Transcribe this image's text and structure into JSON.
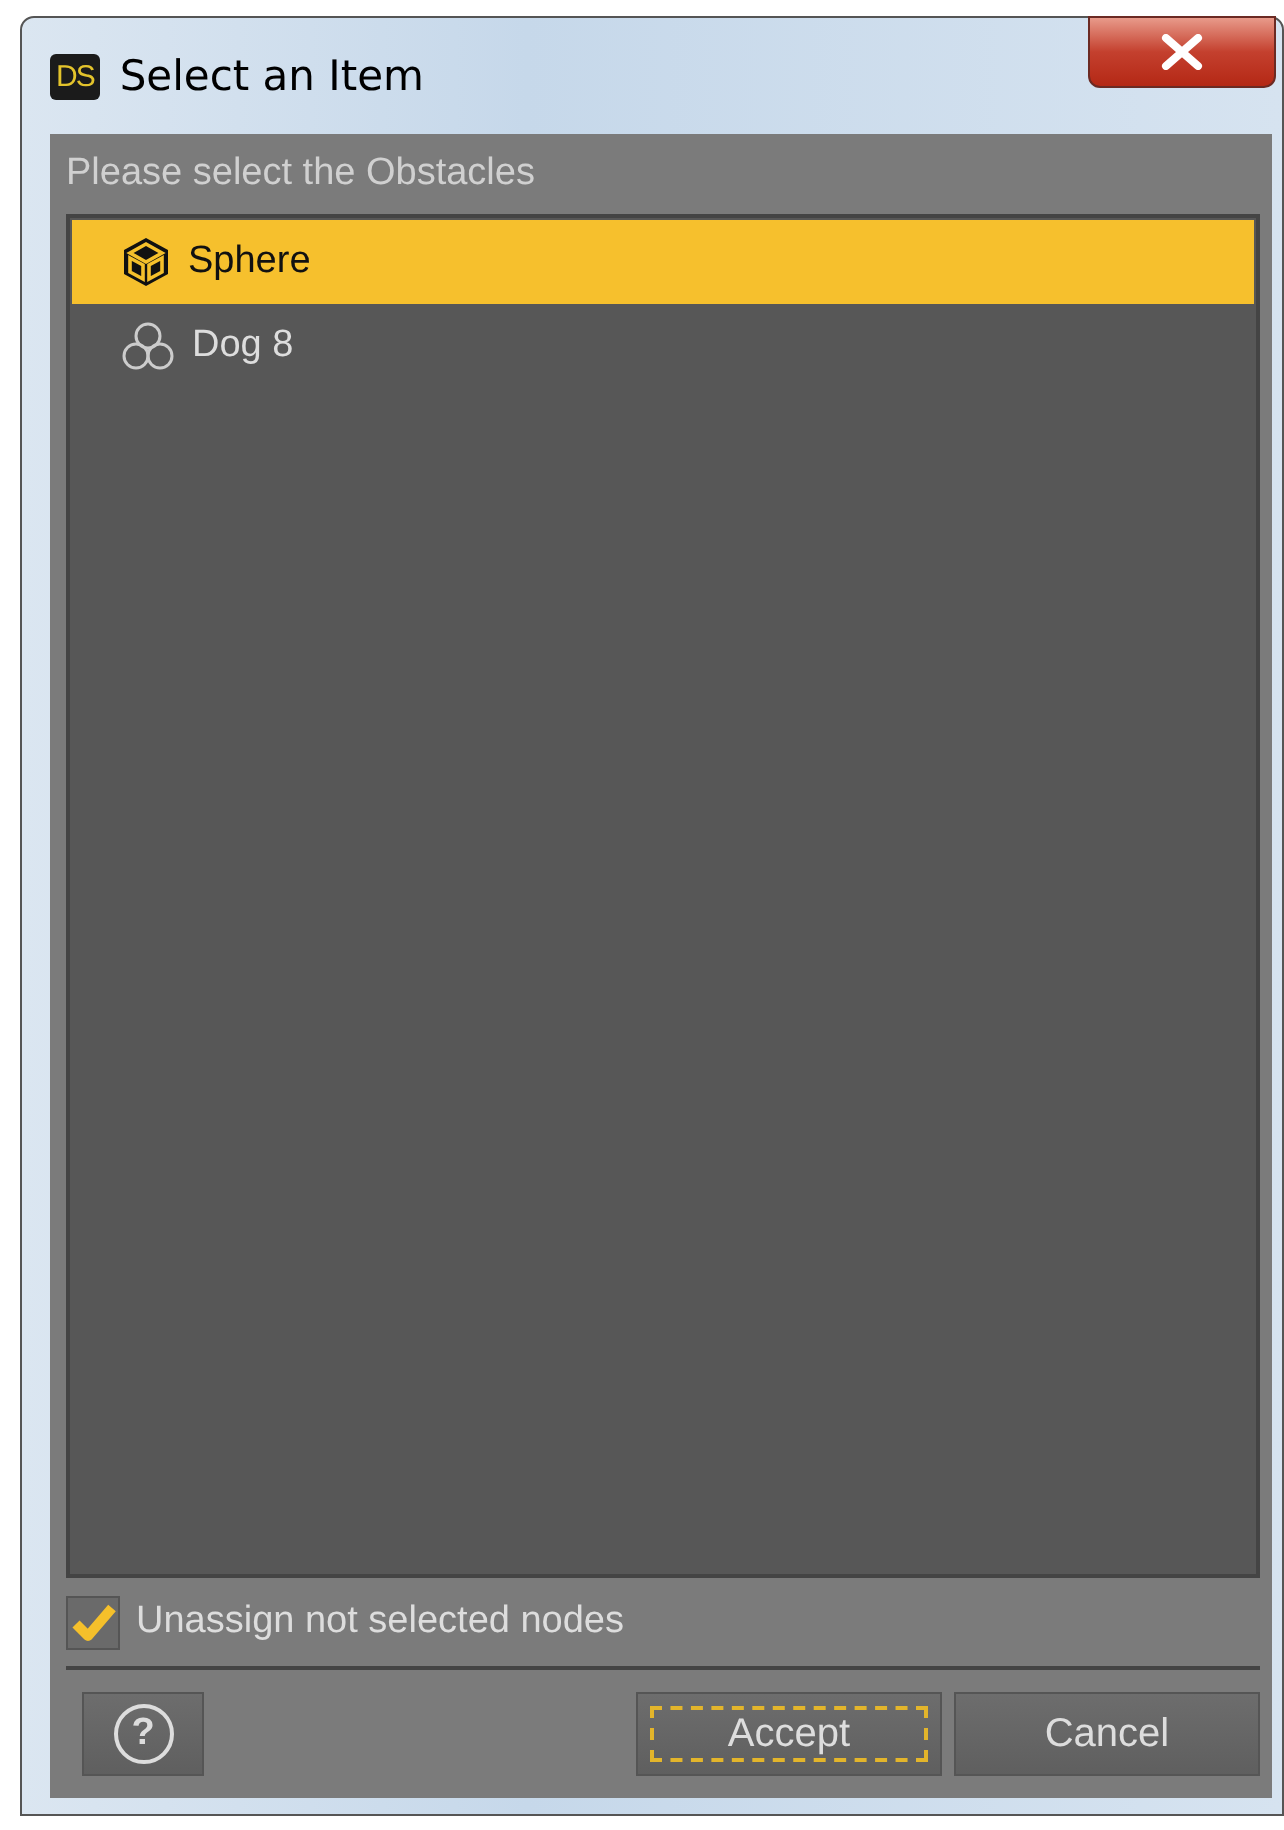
{
  "window": {
    "logo": "DS",
    "title": "Select an Item"
  },
  "prompt": "Please select the Obstacles",
  "items": [
    {
      "label": "Sphere",
      "kind": "prop",
      "selected": true
    },
    {
      "label": "Dog 8",
      "kind": "figure",
      "selected": false
    }
  ],
  "option": {
    "label": "Unassign not selected nodes",
    "checked": true
  },
  "help_button": "?",
  "buttons": [
    {
      "label": "Accept",
      "focused": true
    },
    {
      "label": "Cancel",
      "focused": false
    }
  ]
}
